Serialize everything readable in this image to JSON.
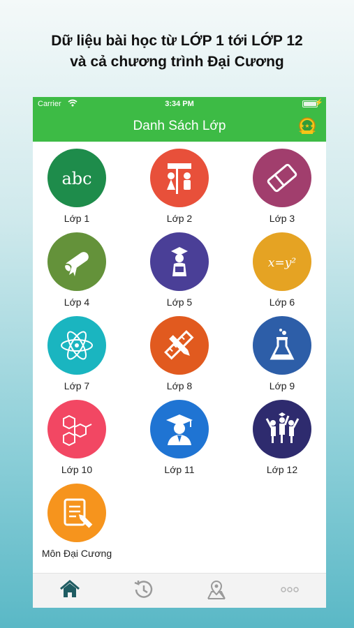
{
  "headline": {
    "line1": "Dữ liệu bài học từ LỚP 1 tới LỚP 12",
    "line2": "và cả chương trình Đại Cương"
  },
  "status_bar": {
    "carrier": "Carrier",
    "time": "3:34 PM"
  },
  "nav": {
    "title": "Danh Sách Lớp",
    "badge_icon": "stars-medal-icon"
  },
  "classes": [
    {
      "label": "Lớp 1",
      "color": "#1e8c4b",
      "icon": "abc-icon",
      "glyph": "abc"
    },
    {
      "label": "Lớp 2",
      "color": "#e8503a",
      "icon": "school-children-icon"
    },
    {
      "label": "Lớp 3",
      "color": "#a13e6d",
      "icon": "eraser-icon"
    },
    {
      "label": "Lớp 4",
      "color": "#64923a",
      "icon": "diploma-scroll-icon"
    },
    {
      "label": "Lớp 5",
      "color": "#4a3f97",
      "icon": "student-graduate-icon"
    },
    {
      "label": "Lớp 6",
      "color": "#e5a323",
      "icon": "math-formula-icon",
      "glyph": "x=y²"
    },
    {
      "label": "Lớp 7",
      "color": "#1ab5c0",
      "icon": "atom-icon"
    },
    {
      "label": "Lớp 8",
      "color": "#e15a1f",
      "icon": "pencil-ruler-icon"
    },
    {
      "label": "Lớp 9",
      "color": "#2d5ea8",
      "icon": "lab-flask-icon"
    },
    {
      "label": "Lớp 10",
      "color": "#f24763",
      "icon": "molecule-icon"
    },
    {
      "label": "Lớp 11",
      "color": "#1f74d3",
      "icon": "graduate-icon"
    },
    {
      "label": "Lớp 12",
      "color": "#2e2b6e",
      "icon": "celebrating-students-icon"
    },
    {
      "label": "Môn Đại Cương",
      "color": "#f6941d",
      "icon": "document-edit-icon"
    }
  ],
  "tabs": [
    {
      "name": "home",
      "icon": "home-icon",
      "active": true,
      "color": "#1f5c62"
    },
    {
      "name": "history",
      "icon": "history-icon",
      "active": false,
      "color": "#9a9a9a"
    },
    {
      "name": "map",
      "icon": "map-pin-icon",
      "active": false,
      "color": "#9a9a9a"
    },
    {
      "name": "more",
      "icon": "more-dots-icon",
      "active": false,
      "color": "#b5b5b5"
    }
  ]
}
